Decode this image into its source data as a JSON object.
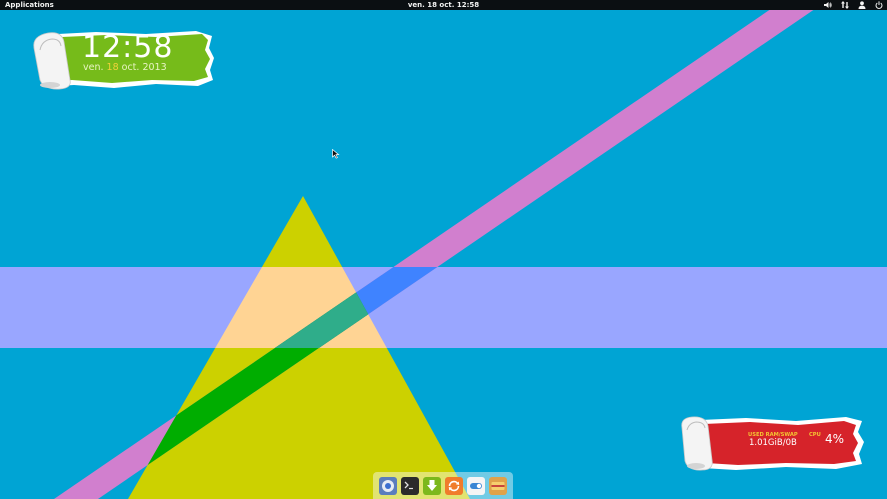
{
  "panel": {
    "applications_label": "Applications",
    "datetime": "ven. 18 oct. 12:58",
    "indicator_icons": [
      "volume-icon",
      "network-icon",
      "user-icon",
      "power-icon"
    ]
  },
  "clock_widget": {
    "time": "12:58",
    "date_prefix": "ven. ",
    "date_day": "18",
    "date_suffix": " oct. 2013"
  },
  "system_monitor": {
    "ram_label": "USED RAM/SWAP",
    "ram_value": "1.01GiB/0B",
    "cpu_label": "CPU",
    "cpu_value": "4%"
  },
  "dock": {
    "items": [
      {
        "name": "Chromium",
        "icon": "chromium-icon"
      },
      {
        "name": "Terminal",
        "icon": "terminal-icon"
      },
      {
        "name": "Download",
        "icon": "download-icon"
      },
      {
        "name": "Update",
        "icon": "update-icon"
      },
      {
        "name": "Settings",
        "icon": "toggle-settings-icon"
      },
      {
        "name": "Files",
        "icon": "files-icon"
      }
    ]
  },
  "colors": {
    "wallpaper_bg": "#00a4d4",
    "panel_bg": "#0b0f12",
    "clock_green": "#76bb1a",
    "sysmon_red": "#d6232a"
  }
}
